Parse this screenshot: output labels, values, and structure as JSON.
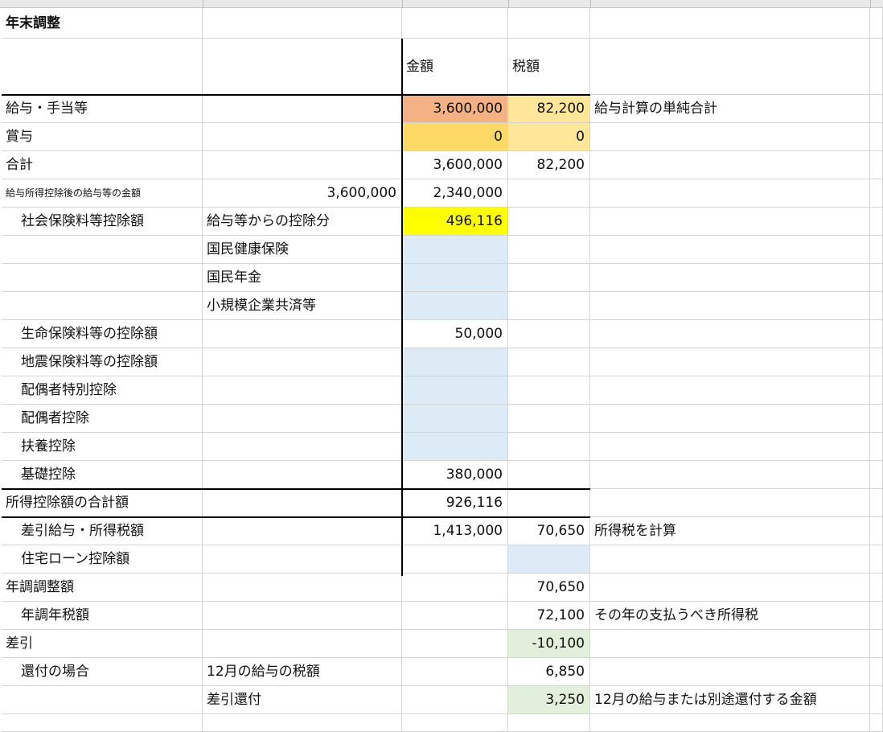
{
  "title": "年末調整",
  "header": {
    "amount": "金額",
    "tax": "税額"
  },
  "colors": {
    "salary_amount": "#F4B183",
    "salary_tax": "#FFE699",
    "bonus_amount": "#FFD966",
    "bonus_tax": "#FFE699",
    "input_blue": "#DDEBF7",
    "highlight_yellow": "#FFFF00",
    "result_green": "#E2EFDA"
  },
  "rows": {
    "salary": {
      "label": "給与・手当等",
      "amount": "3,600,000",
      "tax": "82,200",
      "note": "給与計算の単純合計"
    },
    "bonus": {
      "label": "賞与",
      "amount": "0",
      "tax": "0"
    },
    "total": {
      "label": "合計",
      "amount": "3,600,000",
      "tax": "82,200"
    },
    "after_deduction": {
      "label": "給与所得控除後の給与等の金額",
      "b": "3,600,000",
      "amount": "2,340,000"
    },
    "social": {
      "label": "社会保険料等控除額",
      "b": "給与等からの控除分",
      "amount": "496,116"
    },
    "health": {
      "b": "国民健康保険"
    },
    "pension": {
      "b": "国民年金"
    },
    "small_biz": {
      "b": "小規模企業共済等"
    },
    "life": {
      "label": "生命保険料等の控除額",
      "amount": "50,000"
    },
    "earthquake": {
      "label": "地震保険料等の控除額"
    },
    "spouse_special": {
      "label": "配偶者特別控除"
    },
    "spouse": {
      "label": "配偶者控除"
    },
    "dependents": {
      "label": "扶養控除"
    },
    "basic": {
      "label": "基礎控除",
      "amount": "380,000"
    },
    "deduction_total": {
      "label": "所得控除額の合計額",
      "amount": "926,116"
    },
    "taxable": {
      "label": "差引給与・所得税額",
      "amount": "1,413,000",
      "tax": "70,650",
      "note": "所得税を計算"
    },
    "housing": {
      "label": "住宅ローン控除額"
    },
    "adjusted": {
      "label": "年調調整額",
      "tax": "70,650"
    },
    "annual_tax": {
      "label": "年調年税額",
      "tax": "72,100",
      "note": "その年の支払うべき所得税"
    },
    "difference": {
      "label": "差引",
      "tax": "-10,100"
    },
    "refund_case": {
      "label": "還付の場合",
      "b": "12月の給与の税額",
      "tax": "6,850"
    },
    "refund": {
      "b": "差引還付",
      "tax": "3,250",
      "note": "12月の給与または別途還付する金額"
    }
  }
}
